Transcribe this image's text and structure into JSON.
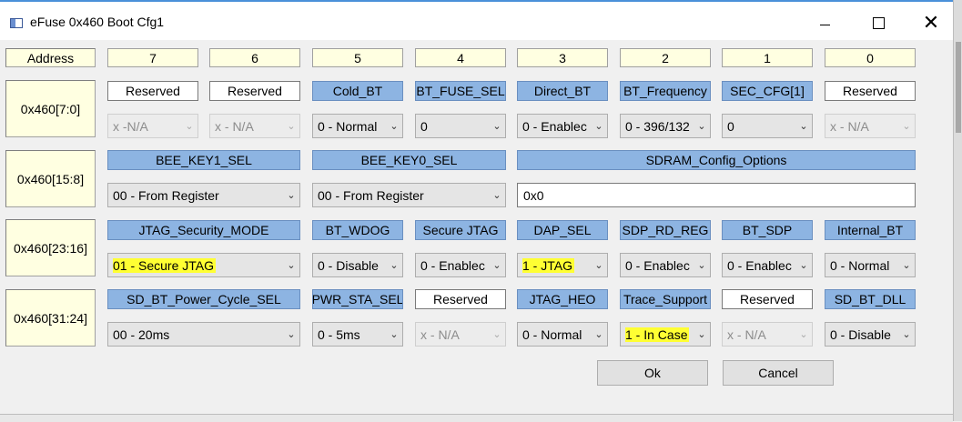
{
  "window": {
    "title": "eFuse 0x460 Boot Cfg1",
    "minimize_icon": "minimize-icon",
    "maximize_icon": "maximize-icon",
    "close_icon": "close-icon",
    "close_glyph": "✕"
  },
  "header": {
    "address": "Address",
    "bits": [
      "7",
      "6",
      "5",
      "4",
      "3",
      "2",
      "1",
      "0"
    ]
  },
  "rows": [
    {
      "address": "0x460[7:0]",
      "labels": [
        "Reserved",
        "Reserved",
        "Cold_BT",
        "BT_FUSE_SEL",
        "Direct_BT",
        "BT_Frequency",
        "SEC_CFG[1]",
        "Reserved"
      ],
      "values": [
        "x -N/A",
        "x - N/A",
        "0 - Normal",
        "0",
        "0 - Enablec",
        "0 - 396/132",
        "0",
        "x - N/A"
      ]
    },
    {
      "address": "0x460[15:8]",
      "labels": [
        "BEE_KEY1_SEL",
        "BEE_KEY0_SEL",
        "SDRAM_Config_Options"
      ],
      "values": [
        "00 - From Register",
        "00 - From Register",
        "0x0"
      ]
    },
    {
      "address": "0x460[23:16]",
      "labels": [
        "JTAG_Security_MODE",
        "BT_WDOG",
        "Secure JTAG",
        "DAP_SEL",
        "SDP_RD_REG",
        "BT_SDP",
        "Internal_BT"
      ],
      "values": [
        "01 - Secure JTAG",
        "0 - Disable",
        "0 - Enablec",
        "1 - JTAG",
        "0 - Enablec",
        "0 - Enablec",
        "0 - Normal"
      ]
    },
    {
      "address": "0x460[31:24]",
      "labels": [
        "SD_BT_Power_Cycle_SEL",
        "PWR_STA_SEL",
        "Reserved",
        "JTAG_HEO",
        "Trace_Support",
        "Reserved",
        "SD_BT_DLL"
      ],
      "values": [
        "00 - 20ms",
        "0 - 5ms",
        "x - N/A",
        "0 - Normal",
        "1 - In Case",
        "x - N/A",
        "0 - Disable"
      ]
    }
  ],
  "buttons": {
    "ok": "Ok",
    "cancel": "Cancel"
  },
  "colors": {
    "label_blue": "#8db4e2",
    "address_yellow": "#ffffe1",
    "highlight": "#ffff33"
  },
  "dropdown_icon": "chevron-down-icon"
}
